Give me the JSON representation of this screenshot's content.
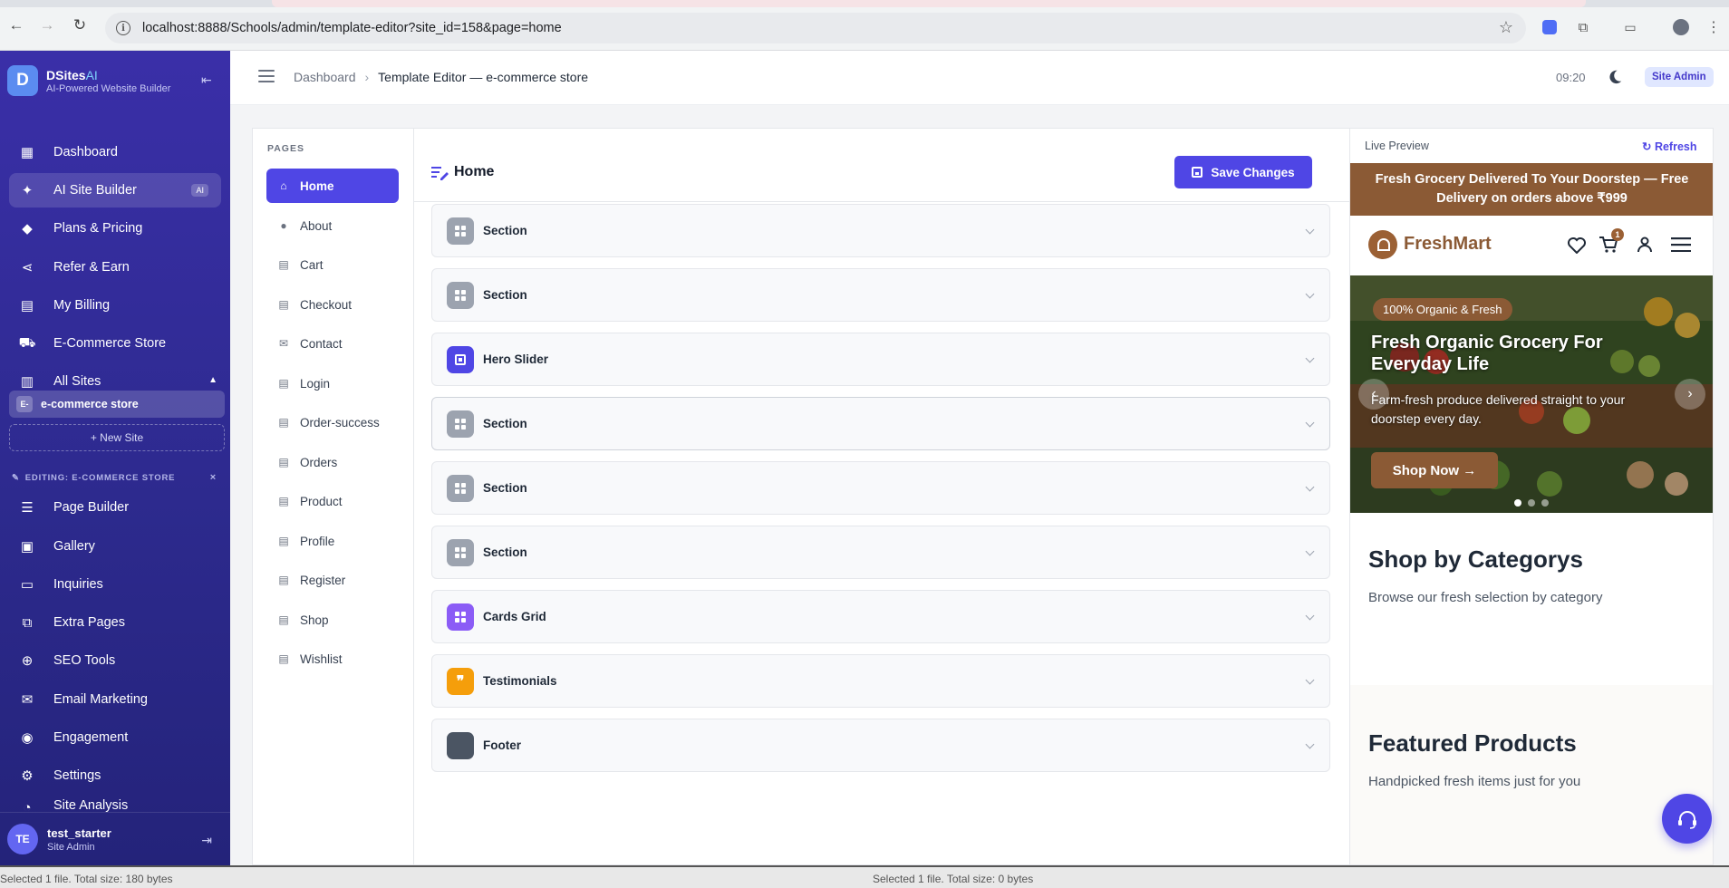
{
  "browser": {
    "url": "localhost:8888/Schools/admin/template-editor?site_id=158&page=home"
  },
  "sidebar": {
    "brand_name": "DSites",
    "brand_ai": "AI",
    "brand_tagline": "AI-Powered Website Builder",
    "logo_letter": "D",
    "items": [
      {
        "label": "Dashboard",
        "icon": "dashboard-icon"
      },
      {
        "label": "AI Site Builder",
        "icon": "sparkle-icon",
        "badge": "AI"
      },
      {
        "label": "Plans & Pricing",
        "icon": "diamond-icon"
      },
      {
        "label": "Refer & Earn",
        "icon": "share-icon"
      },
      {
        "label": "My Billing",
        "icon": "receipt-icon"
      },
      {
        "label": "E-Commerce Store",
        "icon": "cart-icon"
      },
      {
        "label": "All Sites",
        "icon": "building-icon"
      }
    ],
    "site_chip": {
      "prefix": "E-",
      "label": "e-commerce store"
    },
    "new_site": "+ New Site",
    "editing_label": "EDITING: E-COMMERCE STORE",
    "editing_close": "×",
    "editing_items": [
      {
        "label": "Page Builder",
        "icon": "edit-list-icon"
      },
      {
        "label": "Gallery",
        "icon": "gallery-icon"
      },
      {
        "label": "Inquiries",
        "icon": "inbox-icon"
      },
      {
        "label": "Extra Pages",
        "icon": "pages-icon"
      },
      {
        "label": "SEO Tools",
        "icon": "seo-icon"
      },
      {
        "label": "Email Marketing",
        "icon": "email-icon"
      },
      {
        "label": "Engagement",
        "icon": "engagement-icon"
      },
      {
        "label": "Settings",
        "icon": "gear-icon"
      },
      {
        "label": "Site Analysis",
        "icon": "analysis-icon"
      }
    ],
    "user": {
      "initials": "TE",
      "name": "test_starter",
      "role": "Site Admin"
    }
  },
  "topbar": {
    "crumb_root": "Dashboard",
    "crumb_sep": "›",
    "crumb_current": "Template Editor — e-commerce store",
    "time": "09:20",
    "role_badge": "Site Admin"
  },
  "pages_panel": {
    "label": "PAGES",
    "pages": [
      "Home",
      "About",
      "Cart",
      "Checkout",
      "Contact",
      "Login",
      "Order-success",
      "Orders",
      "Product",
      "Profile",
      "Register",
      "Shop",
      "Wishlist"
    ],
    "active": "Home"
  },
  "editor": {
    "title": "Home",
    "save_label": "Save Changes",
    "sections": [
      {
        "name": "Section",
        "color": "#9ca3af",
        "icon": "grid-icon"
      },
      {
        "name": "Section",
        "color": "#9ca3af",
        "icon": "grid-icon"
      },
      {
        "name": "Hero Slider",
        "color": "#4f46e5",
        "icon": "slider-icon"
      },
      {
        "name": "Section",
        "color": "#9ca3af",
        "icon": "grid-icon"
      },
      {
        "name": "Section",
        "color": "#9ca3af",
        "icon": "grid-icon"
      },
      {
        "name": "Section",
        "color": "#9ca3af",
        "icon": "grid-icon"
      },
      {
        "name": "Cards Grid",
        "color": "#8b5cf6",
        "icon": "grid-icon"
      },
      {
        "name": "Testimonials",
        "color": "#f59e0b",
        "icon": "quote-icon"
      },
      {
        "name": "Footer",
        "color": "#4b5563",
        "icon": "footer-icon"
      }
    ]
  },
  "preview": {
    "label": "Live Preview",
    "refresh": "Refresh",
    "announcement": "Fresh Grocery Delivered To Your Doorstep — Free Delivery on orders above ₹999",
    "shop_name": "FreshMart",
    "cart_count": "1",
    "hero_pill": "100% Organic & Fresh",
    "hero_title": "Fresh Organic Grocery For Everyday Life",
    "hero_text": "Farm-fresh produce delivered straight to your doorstep every day.",
    "hero_button": "Shop Now →",
    "categories_title": "Shop by Categorys",
    "categories_sub": "Browse our fresh selection by category",
    "featured_title": "Featured Products",
    "featured_sub": "Handpicked fresh items just for you",
    "accent": "#8b5a35"
  },
  "status_bar": {
    "left": "Selected 1 file. Total size: 180 bytes",
    "right": "Selected 1 file. Total size: 0 bytes"
  }
}
